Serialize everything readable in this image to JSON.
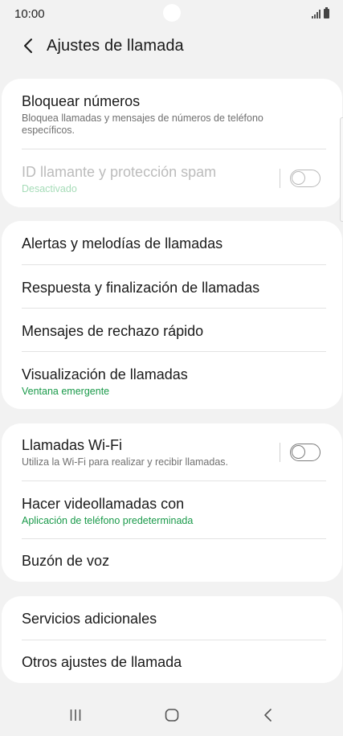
{
  "status_bar": {
    "time": "10:00"
  },
  "header": {
    "title": "Ajustes de llamada"
  },
  "groups": [
    {
      "items": [
        {
          "title": "Bloquear números",
          "subtitle": "Bloquea llamadas y mensajes de números de teléfono específicos."
        },
        {
          "title": "ID llamante y protección spam",
          "subtitle": "Desactivado",
          "toggle": false,
          "disabled": true
        }
      ]
    },
    {
      "items": [
        {
          "title": "Alertas y melodías de llamadas"
        },
        {
          "title": "Respuesta y finalización de llamadas"
        },
        {
          "title": "Mensajes de rechazo rápido"
        },
        {
          "title": "Visualización de llamadas",
          "subtitle": "Ventana emergente"
        }
      ]
    },
    {
      "items": [
        {
          "title": "Llamadas Wi-Fi",
          "subtitle": "Utiliza la Wi-Fi para realizar y recibir llamadas.",
          "toggle": false
        },
        {
          "title": "Hacer videollamadas con",
          "subtitle": "Aplicación de teléfono predeterminada"
        },
        {
          "title": "Buzón de voz"
        }
      ]
    },
    {
      "items": [
        {
          "title": "Servicios adicionales"
        },
        {
          "title": "Otros ajustes de llamada"
        }
      ]
    }
  ],
  "colors": {
    "background": "#f2f2f2",
    "card": "#ffffff",
    "accent_green": "#1a9a4a",
    "disabled_text": "#bcbcbc"
  },
  "icons": {
    "back": "chevron-left-icon",
    "recents": "recent-apps-icon",
    "home": "home-icon",
    "nav_back": "nav-back-icon"
  }
}
